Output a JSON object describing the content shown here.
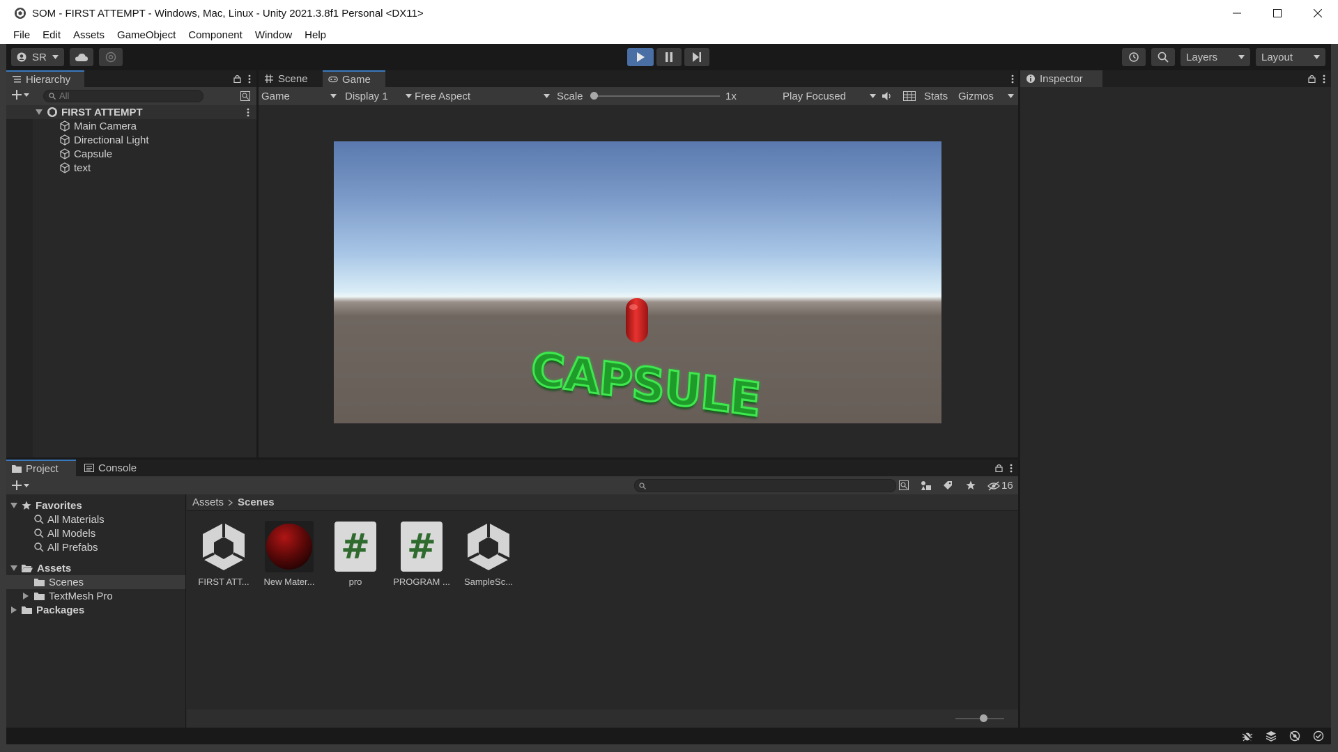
{
  "window": {
    "title": "SOM - FIRST ATTEMPT - Windows, Mac, Linux - Unity 2021.3.8f1 Personal <DX11>"
  },
  "menu": [
    "File",
    "Edit",
    "Assets",
    "GameObject",
    "Component",
    "Window",
    "Help"
  ],
  "toolbar": {
    "account_label": "SR",
    "layers_label": "Layers",
    "layout_label": "Layout"
  },
  "hierarchy": {
    "tab_label": "Hierarchy",
    "search_placeholder": "All",
    "scene_name": "FIRST ATTEMPT",
    "items": [
      "Main Camera",
      "Directional Light",
      "Capsule",
      "text"
    ]
  },
  "gameview": {
    "tabs": [
      "Scene",
      "Game"
    ],
    "active_tab": "Game",
    "view_mode": "Game",
    "display": "Display 1",
    "aspect": "Free Aspect",
    "scale_label": "Scale",
    "scale_value": "1x",
    "play_mode": "Play Focused",
    "stats_label": "Stats",
    "gizmos_label": "Gizmos",
    "scene_text": "CAPSULE"
  },
  "inspector": {
    "tab_label": "Inspector"
  },
  "project": {
    "tabs": [
      "Project",
      "Console"
    ],
    "favorites_label": "Favorites",
    "favorites": [
      "All Materials",
      "All Models",
      "All Prefabs"
    ],
    "assets_label": "Assets",
    "asset_folders": [
      "Scenes",
      "TextMesh Pro"
    ],
    "packages_label": "Packages",
    "breadcrumb": [
      "Assets",
      "Scenes"
    ],
    "hidden_count": "16",
    "assets": [
      {
        "name": "FIRST ATT...",
        "kind": "unity-scene-icon"
      },
      {
        "name": "New Mater...",
        "kind": "material-sphere-icon"
      },
      {
        "name": "pro",
        "kind": "csharp-script-icon"
      },
      {
        "name": "PROGRAM ...",
        "kind": "csharp-script-icon"
      },
      {
        "name": "SampleSc...",
        "kind": "unity-scene-icon"
      }
    ]
  },
  "colors": {
    "play_accent": "#4a6fa5",
    "tab_accent": "#3a79bb",
    "capsule_red": "#d0201f",
    "text_green": "#2fc93a"
  }
}
